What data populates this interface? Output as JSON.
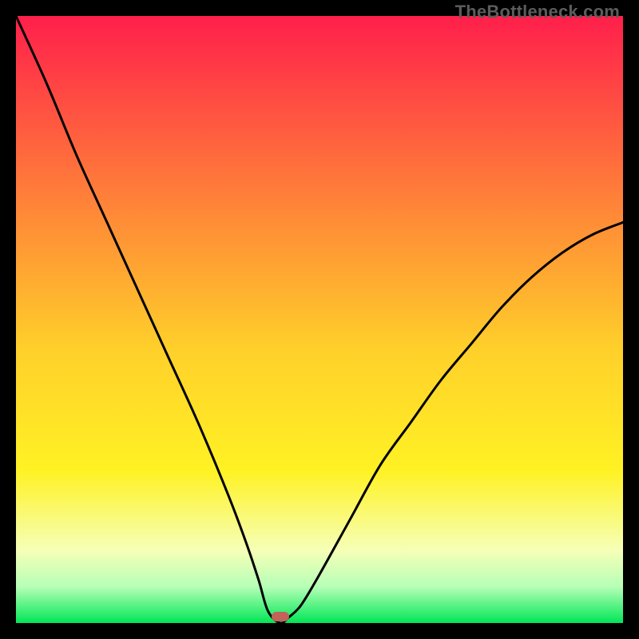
{
  "watermark": "TheBottleneck.com",
  "colors": {
    "gradient_top": "#ff1f4b",
    "gradient_mid1": "#ff7a3a",
    "gradient_mid2": "#ffd02a",
    "gradient_mid3": "#fff224",
    "gradient_pale": "#f6ffb7",
    "gradient_green_pale": "#b7ffb7",
    "gradient_green": "#00e756",
    "curve": "#000000",
    "black": "#000000",
    "marker": "#c1625b"
  },
  "chart_data": {
    "type": "line",
    "title": "",
    "xlabel": "",
    "ylabel": "",
    "xlim": [
      0,
      100
    ],
    "ylim": [
      0,
      100
    ],
    "note": "No axes or tick labels are rendered; values are approximate pixel-derived shape of the curve (y = bottleneck %, x = normalized horizontal position).",
    "marker": {
      "x": 43.5,
      "y": 1.0,
      "shape": "pill"
    },
    "green_band": {
      "y_from": 0,
      "y_to": 4
    },
    "series": [
      {
        "name": "bottleneck-curve",
        "x": [
          0,
          5,
          10,
          15,
          20,
          25,
          30,
          35,
          38,
          40,
          41.5,
          43.5,
          45,
          47,
          50,
          55,
          60,
          65,
          70,
          75,
          80,
          85,
          90,
          95,
          100
        ],
        "values": [
          100,
          89,
          77,
          66,
          55,
          44,
          33,
          21,
          13,
          7,
          2,
          0,
          1,
          3,
          8,
          17,
          26,
          33,
          40,
          46,
          52,
          57,
          61,
          64,
          66
        ]
      }
    ]
  }
}
